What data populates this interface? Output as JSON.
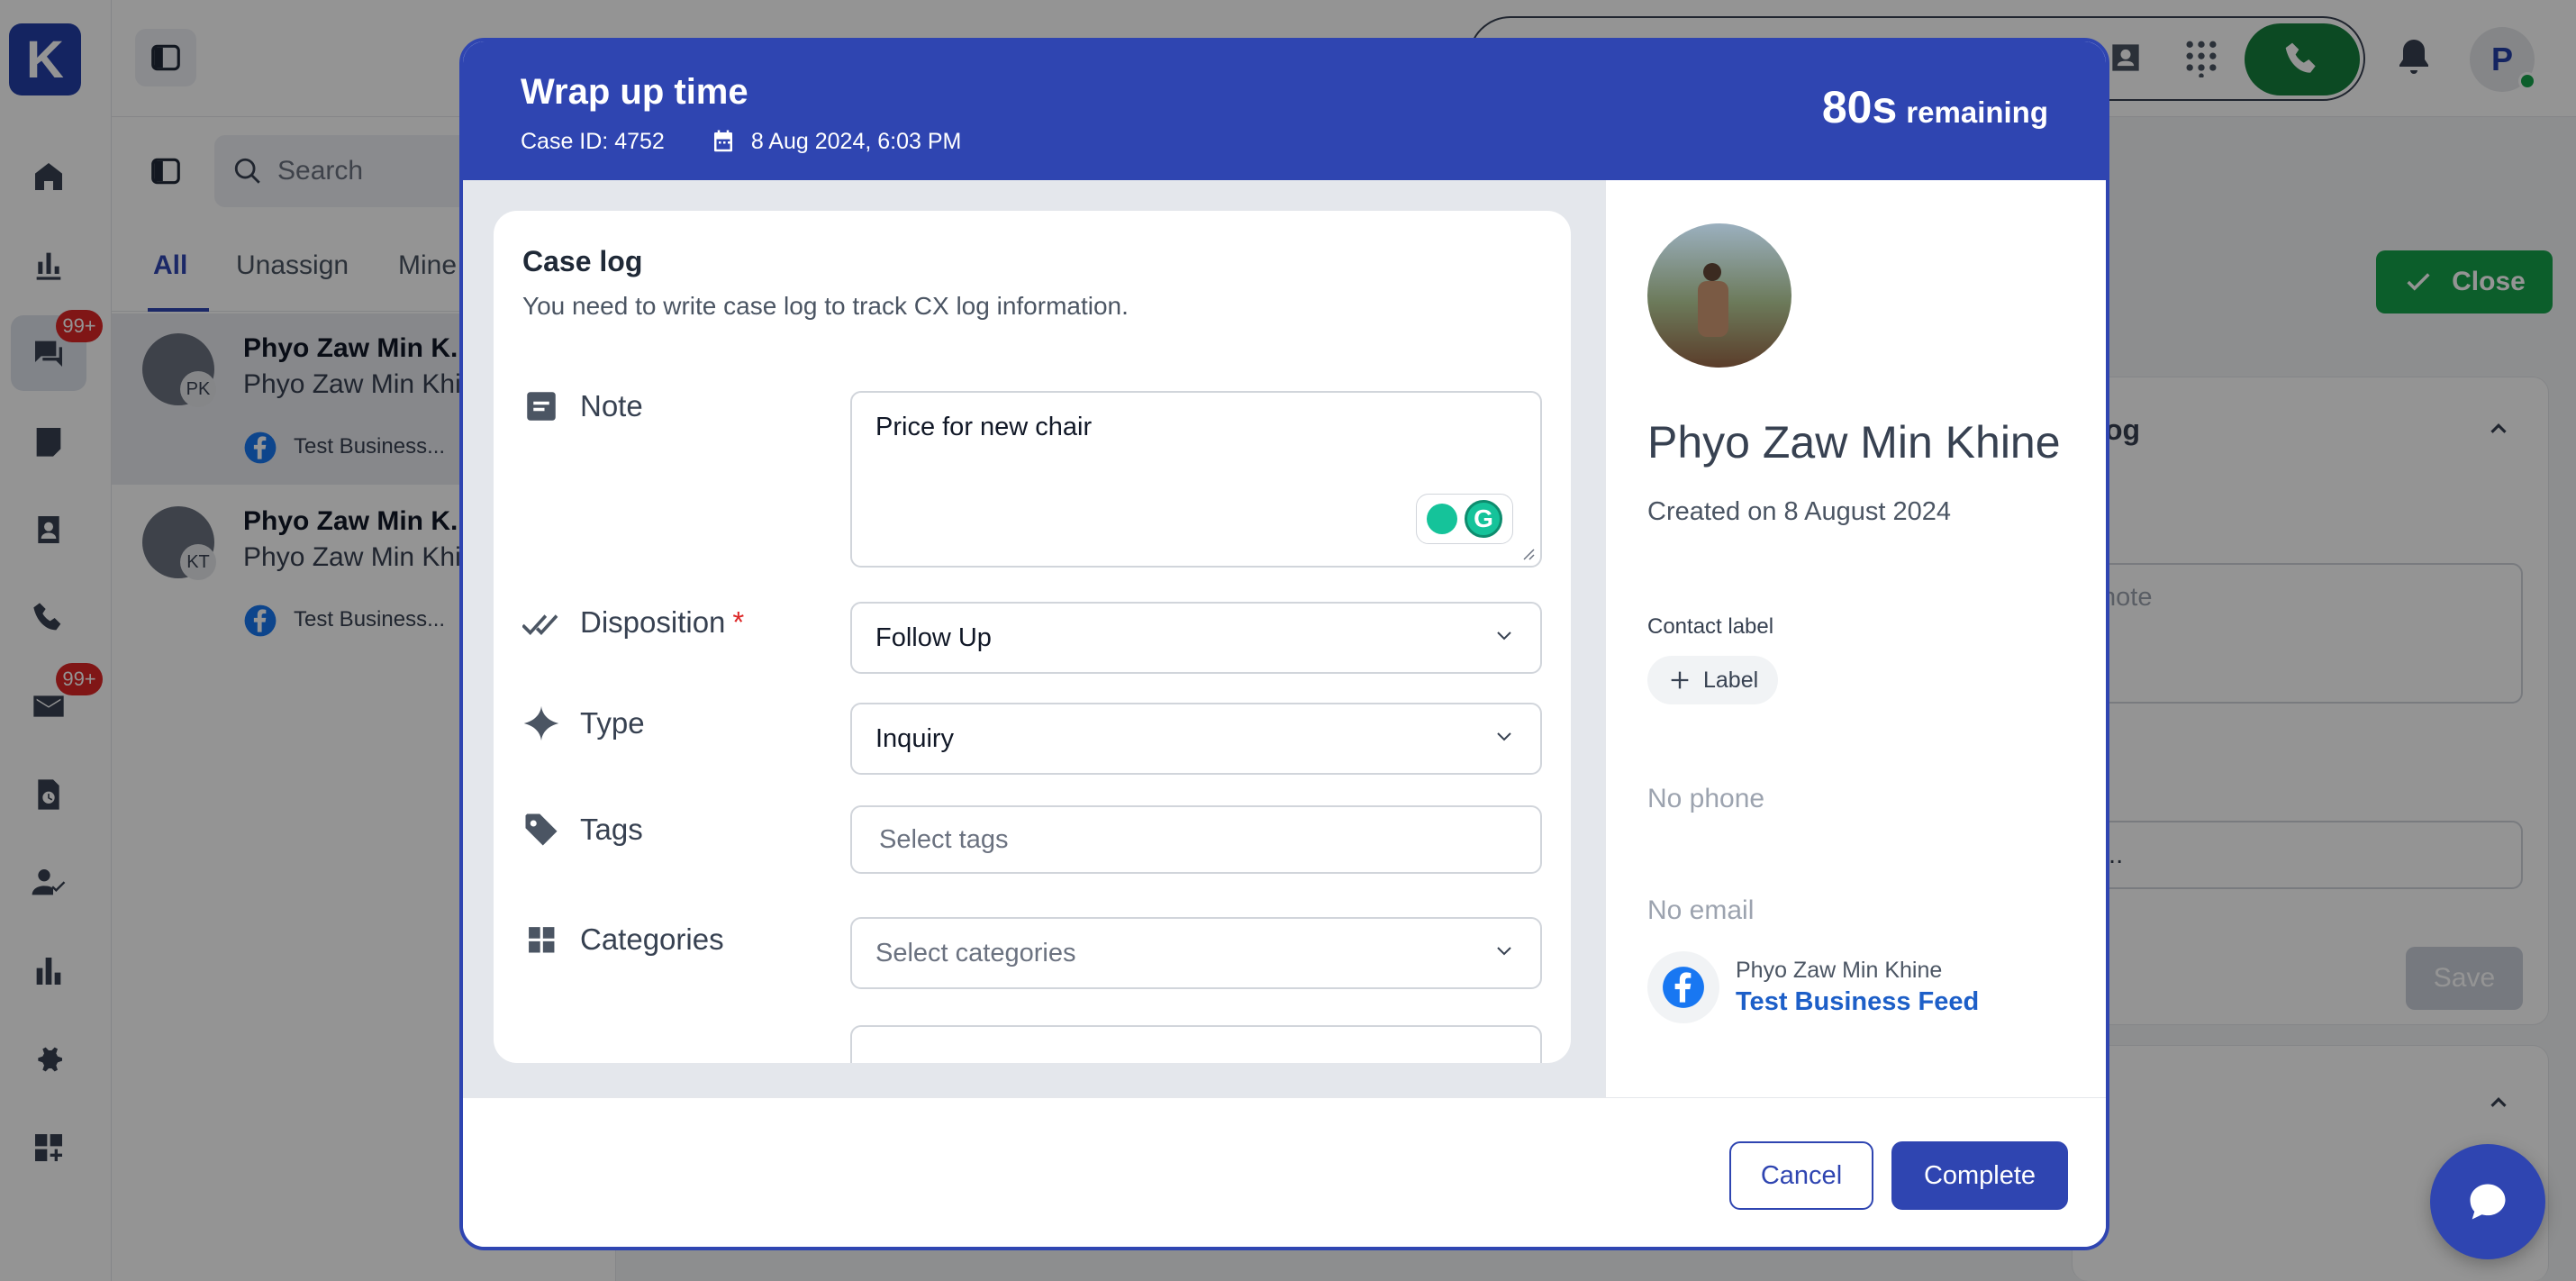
{
  "app": {
    "logo_letter": "K",
    "badges": {
      "conversations": "99+",
      "email": "99+"
    },
    "user_initial": "P",
    "accent_color": "#2f45b1",
    "success_color": "#16a34a"
  },
  "inbox": {
    "search_placeholder": "Search",
    "tabs": [
      "All",
      "Unassign",
      "Mine"
    ],
    "conversations": [
      {
        "initials": "PK",
        "name": "Phyo Zaw Min K...",
        "subtitle": "Phyo Zaw Min Khi",
        "source": "Test Business..."
      },
      {
        "initials": "KT",
        "name": "Phyo Zaw Min K...",
        "subtitle": "Phyo Zaw Min Khi",
        "source": "Test Business..."
      }
    ]
  },
  "right_panel": {
    "close_label": "Close",
    "section_title_fragment": "og",
    "note_placeholder_fragment": "note",
    "input_fragment": "...",
    "save_label": "Save"
  },
  "modal": {
    "title": "Wrap up time",
    "case_id_text": "Case ID: 4752",
    "date_text": "8 Aug 2024, 6:03 PM",
    "timer_value": "80s",
    "timer_suffix": "remaining",
    "case_log": {
      "title": "Case log",
      "description": "You need to write case log to track CX log information.",
      "note": {
        "label": "Note",
        "value": "Price for new chair",
        "icon": "note-icon"
      },
      "disposition": {
        "label": "Disposition",
        "required_mark": "*",
        "value": "Follow Up",
        "icon": "double-check-icon"
      },
      "type": {
        "label": "Type",
        "value": "Inquiry",
        "icon": "sparkle-icon"
      },
      "tags": {
        "label": "Tags",
        "placeholder": "Select tags",
        "icon": "tag-icon"
      },
      "categories": {
        "label": "Categories",
        "placeholder": "Select categories",
        "icon": "grid-icon"
      }
    },
    "contact": {
      "name": "Phyo Zaw Min Khine",
      "created": "Created on 8 August 2024",
      "label_title": "Contact label",
      "label_button": "Label",
      "phone": "No phone",
      "email": "No email",
      "channel_name": "Phyo Zaw Min Khine",
      "channel_feed": "Test Business Feed"
    },
    "footer": {
      "cancel_label": "Cancel",
      "complete_label": "Complete"
    }
  }
}
